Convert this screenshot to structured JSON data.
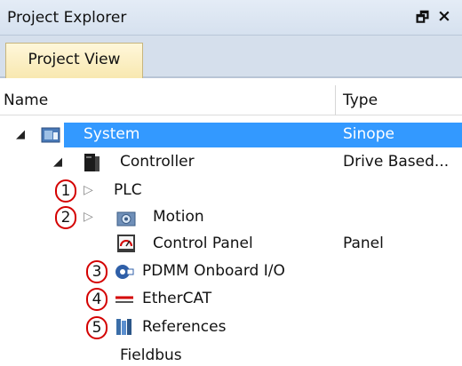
{
  "panel": {
    "title": "Project Explorer",
    "pin_glyph": "🗗",
    "close_glyph": "×"
  },
  "tabs": [
    {
      "label": "Project View"
    }
  ],
  "columns": {
    "name": "Name",
    "type": "Type"
  },
  "tree": {
    "system": {
      "label": "System",
      "type": "Sinope",
      "icon": "system-icon",
      "expanded": true,
      "selected": true
    },
    "controller": {
      "label": "Controller",
      "type": "Drive Based...",
      "icon": "controller-icon",
      "expanded": true
    },
    "plc": {
      "label": "PLC",
      "expanded": false
    },
    "motion": {
      "label": "Motion",
      "icon": "motion-icon",
      "expanded": false
    },
    "control_panel": {
      "label": "Control Panel",
      "type": "Panel",
      "icon": "gauge-icon"
    },
    "pdmm": {
      "label": "PDMM Onboard I/O",
      "icon": "io-icon"
    },
    "ethercat": {
      "label": "EtherCAT",
      "icon": "ethercat-icon"
    },
    "references": {
      "label": "References",
      "icon": "books-icon"
    },
    "fieldbus": {
      "label": "Fieldbus"
    }
  },
  "callouts": [
    "1",
    "2",
    "3",
    "4",
    "5"
  ],
  "colors": {
    "selection": "#3399ff",
    "callout_border": "#d40000",
    "tab_active": "#fbefc2"
  }
}
